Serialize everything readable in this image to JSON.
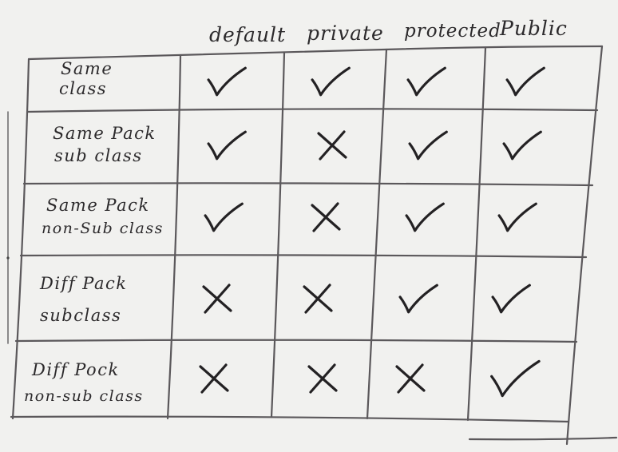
{
  "columns": [
    "default",
    "private",
    "protected",
    "Public"
  ],
  "rows": [
    {
      "label_line1": "Same",
      "label_line2": "class",
      "marks": [
        "check",
        "check",
        "check",
        "check"
      ]
    },
    {
      "label_line1": "Same Pack",
      "label_line2": "sub class",
      "marks": [
        "check",
        "cross",
        "check",
        "check"
      ]
    },
    {
      "label_line1": "Same Pack",
      "label_line2": "non-Sub class",
      "marks": [
        "check",
        "cross",
        "check",
        "check"
      ]
    },
    {
      "label_line1": "Diff Pack",
      "label_line2": "subclass",
      "marks": [
        "cross",
        "cross",
        "check",
        "check"
      ]
    },
    {
      "label_line1": "Diff Pock",
      "label_line2": "non-sub class",
      "marks": [
        "cross",
        "cross",
        "cross",
        "check"
      ]
    }
  ],
  "mark_icons": {
    "check": "check-mark-icon",
    "cross": "cross-mark-icon"
  },
  "colors": {
    "board": "#f1f1ef",
    "ink": "#2c2a2c"
  }
}
